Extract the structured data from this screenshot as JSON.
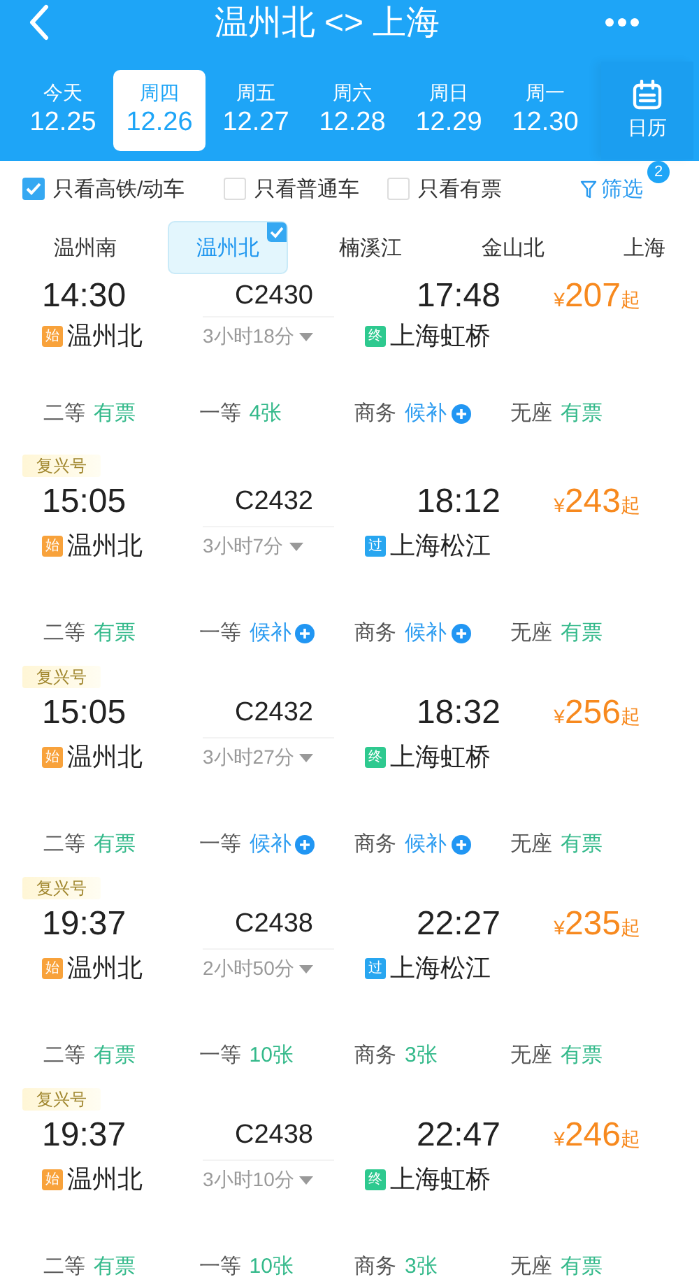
{
  "header": {
    "title": "温州北 <> 上海"
  },
  "dates": [
    {
      "weekday": "今天",
      "date": "12.25",
      "selected": false
    },
    {
      "weekday": "周四",
      "date": "12.26",
      "selected": true
    },
    {
      "weekday": "周五",
      "date": "12.27",
      "selected": false
    },
    {
      "weekday": "周六",
      "date": "12.28",
      "selected": false
    },
    {
      "weekday": "周日",
      "date": "12.29",
      "selected": false
    },
    {
      "weekday": "周一",
      "date": "12.30",
      "selected": false
    }
  ],
  "calendar": {
    "label": "日历"
  },
  "filters": [
    {
      "label": "只看高铁/动车",
      "checked": true
    },
    {
      "label": "只看普通车",
      "checked": false
    },
    {
      "label": "只看有票",
      "checked": false
    }
  ],
  "filter_button": {
    "label": "筛选",
    "badge": "2"
  },
  "stations": [
    {
      "label": "温州南",
      "selected": false
    },
    {
      "label": "温州北",
      "selected": true
    },
    {
      "label": "楠溪江",
      "selected": false
    },
    {
      "label": "金山北",
      "selected": false
    },
    {
      "label": "上海",
      "selected": false
    }
  ],
  "currency": "¥",
  "trains": [
    {
      "depart": "14:30",
      "number": "C2430",
      "arrive": "17:48",
      "price": "207",
      "price_suffix": "起",
      "from": {
        "kind": "origin",
        "tag": "始",
        "name": "温州北"
      },
      "duration": "3小时18分",
      "to": {
        "kind": "terminal",
        "tag": "终",
        "name": "上海虹桥"
      },
      "seats": [
        {
          "class": "二等",
          "status": "有票",
          "kind": "available"
        },
        {
          "class": "一等",
          "status": "4张",
          "kind": "available"
        },
        {
          "class": "商务",
          "status": "候补",
          "kind": "waitlist"
        },
        {
          "class": "无座",
          "status": "有票",
          "kind": "available"
        }
      ]
    },
    {
      "badge": "复兴号",
      "depart": "15:05",
      "number": "C2432",
      "arrive": "18:12",
      "price": "243",
      "price_suffix": "起",
      "from": {
        "kind": "origin",
        "tag": "始",
        "name": "温州北"
      },
      "duration": "3小时7分",
      "to": {
        "kind": "pass",
        "tag": "过",
        "name": "上海松江"
      },
      "seats": [
        {
          "class": "二等",
          "status": "有票",
          "kind": "available"
        },
        {
          "class": "一等",
          "status": "候补",
          "kind": "waitlist"
        },
        {
          "class": "商务",
          "status": "候补",
          "kind": "waitlist"
        },
        {
          "class": "无座",
          "status": "有票",
          "kind": "available"
        }
      ]
    },
    {
      "badge": "复兴号",
      "depart": "15:05",
      "number": "C2432",
      "arrive": "18:32",
      "price": "256",
      "price_suffix": "起",
      "from": {
        "kind": "origin",
        "tag": "始",
        "name": "温州北"
      },
      "duration": "3小时27分",
      "to": {
        "kind": "terminal",
        "tag": "终",
        "name": "上海虹桥"
      },
      "seats": [
        {
          "class": "二等",
          "status": "有票",
          "kind": "available"
        },
        {
          "class": "一等",
          "status": "候补",
          "kind": "waitlist"
        },
        {
          "class": "商务",
          "status": "候补",
          "kind": "waitlist"
        },
        {
          "class": "无座",
          "status": "有票",
          "kind": "available"
        }
      ]
    },
    {
      "badge": "复兴号",
      "depart": "19:37",
      "number": "C2438",
      "arrive": "22:27",
      "price": "235",
      "price_suffix": "起",
      "from": {
        "kind": "origin",
        "tag": "始",
        "name": "温州北"
      },
      "duration": "2小时50分",
      "to": {
        "kind": "pass",
        "tag": "过",
        "name": "上海松江"
      },
      "seats": [
        {
          "class": "二等",
          "status": "有票",
          "kind": "available"
        },
        {
          "class": "一等",
          "status": "10张",
          "kind": "available"
        },
        {
          "class": "商务",
          "status": "3张",
          "kind": "available"
        },
        {
          "class": "无座",
          "status": "有票",
          "kind": "available"
        }
      ]
    },
    {
      "badge": "复兴号",
      "depart": "19:37",
      "number": "C2438",
      "arrive": "22:47",
      "price": "246",
      "price_suffix": "起",
      "from": {
        "kind": "origin",
        "tag": "始",
        "name": "温州北"
      },
      "duration": "3小时10分",
      "to": {
        "kind": "terminal",
        "tag": "终",
        "name": "上海虹桥"
      },
      "seats": [
        {
          "class": "二等",
          "status": "有票",
          "kind": "available"
        },
        {
          "class": "一等",
          "status": "10张",
          "kind": "available"
        },
        {
          "class": "商务",
          "status": "3张",
          "kind": "available"
        },
        {
          "class": "无座",
          "status": "有票",
          "kind": "available"
        }
      ]
    }
  ]
}
